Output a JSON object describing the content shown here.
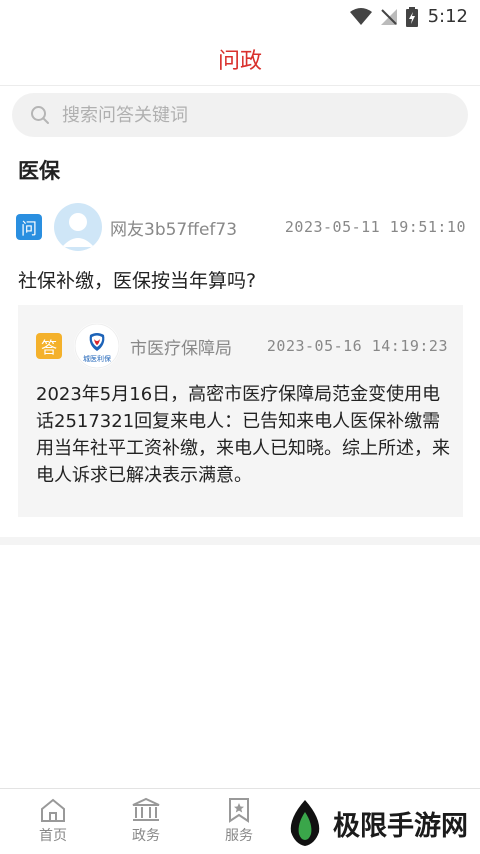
{
  "status_bar": {
    "time": "5:12"
  },
  "header": {
    "title": "问政"
  },
  "search": {
    "placeholder": "搜索问答关键词"
  },
  "section": {
    "title": "医保"
  },
  "question": {
    "badge": "问",
    "user": "网友3b57ffef73",
    "time": "2023-05-11  19:51:10",
    "text": "社保补缴，医保按当年算吗?"
  },
  "answer": {
    "badge": "答",
    "org": "市医疗保障局",
    "logo_text": "城医利保",
    "time": "2023-05-16  14:19:23",
    "text": "2023年5月16日，高密市医疗保障局范金变使用电话2517321回复来电人：已告知来电人医保补缴需用当年社平工资补缴，来电人已知晓。综上所述，来电人诉求已解决表示满意。"
  },
  "nav": {
    "items": [
      {
        "label": "首页",
        "icon": "home-icon"
      },
      {
        "label": "政务",
        "icon": "government-icon"
      },
      {
        "label": "服务",
        "icon": "bookmark-star-icon"
      }
    ]
  },
  "watermark": {
    "text": "极限手游网"
  }
}
